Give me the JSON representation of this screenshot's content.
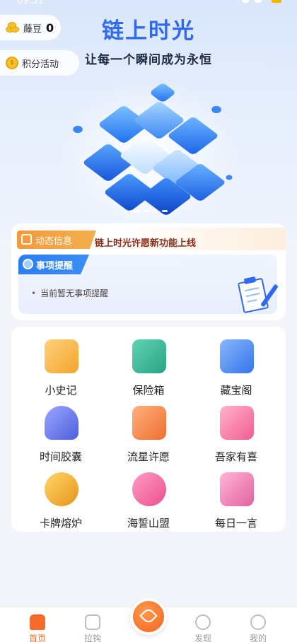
{
  "status_bar": {
    "time": "09:51"
  },
  "header": {
    "beans_label": "藤豆",
    "beans_count": "0",
    "points_label": "积分活动",
    "title": "链上时光",
    "subtitle": "让每一个瞬间成为永恒"
  },
  "banner": {
    "slides": 4,
    "active_slide": 1
  },
  "notice": {
    "tag": "动态信息",
    "text": "链上时光许愿新功能上线"
  },
  "reminder": {
    "tag": "事项提醒",
    "empty_text": "当前暂无事项提醒"
  },
  "features": [
    {
      "label": "小史记",
      "icon": "pencil-note-icon",
      "color": "#f6b53d"
    },
    {
      "label": "保险箱",
      "icon": "safe-icon",
      "color": "#35b89a"
    },
    {
      "label": "藏宝阁",
      "icon": "tray-icon",
      "color": "#3d7ef0"
    },
    {
      "label": "时间胶囊",
      "icon": "gauge-icon",
      "color": "#5a6fe8"
    },
    {
      "label": "流星许愿",
      "icon": "shooting-star-icon",
      "color": "#f48a45"
    },
    {
      "label": "吾家有喜",
      "icon": "heart-envelope-icon",
      "color": "#f46aa0"
    },
    {
      "label": "卡牌熔炉",
      "icon": "cauldron-icon",
      "color": "#f0a62e"
    },
    {
      "label": "海誓山盟",
      "icon": "locked-hearts-icon",
      "color": "#f46aa0"
    },
    {
      "label": "每日一言",
      "icon": "document-icon",
      "color": "#ef76b2"
    }
  ],
  "tabs": [
    {
      "label": "首页",
      "icon": "home-icon",
      "active": true
    },
    {
      "label": "拉钩",
      "icon": "pinky-promise-icon",
      "active": false
    },
    {
      "label": "",
      "icon": "lotus-icon",
      "active": false
    },
    {
      "label": "发现",
      "icon": "planet-icon",
      "active": false
    },
    {
      "label": "我的",
      "icon": "user-icon",
      "active": false
    }
  ],
  "colors": {
    "accent": "#f66b2b",
    "title_blue": "#2f6af0",
    "notice_orange": "#f6993b",
    "reminder_blue": "#2c7cf3"
  }
}
